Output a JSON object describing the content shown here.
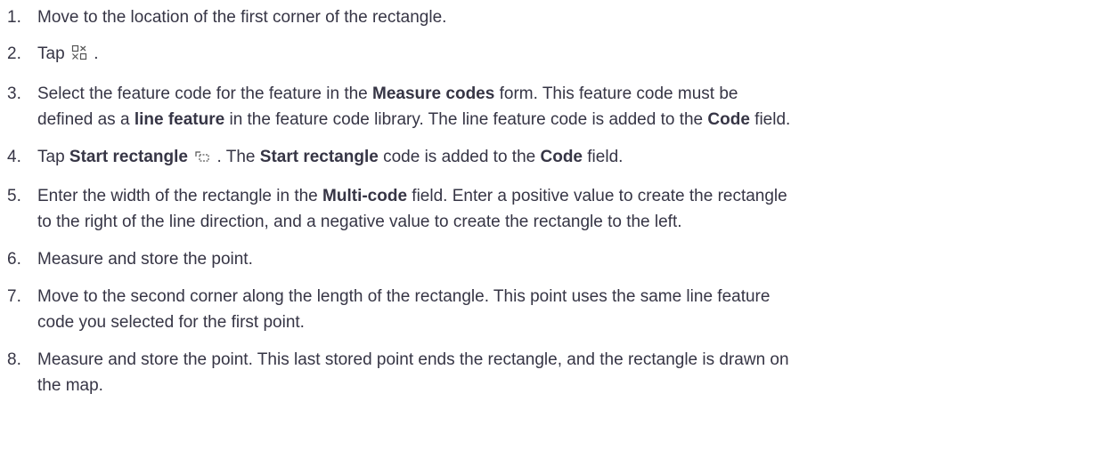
{
  "steps": [
    {
      "number": "1.",
      "text": "Move to the location of the first corner of the rectangle."
    },
    {
      "number": "2.",
      "pre": "Tap ",
      "icon": "measure-codes-icon",
      "post": " ."
    },
    {
      "number": "3.",
      "t1": "Select the feature code for the feature in the ",
      "b1": "Measure codes",
      "t2": " form. This feature code must be",
      "t3": "defined as a ",
      "b2": "line feature",
      "t4": " in the feature code library. The line feature code is added to the ",
      "b3": "Code",
      "t5": " field."
    },
    {
      "number": "4.",
      "t1": "Tap ",
      "b1": "Start rectangle",
      "icon": "start-rectangle-icon",
      "t2": " . The ",
      "b2": "Start rectangle",
      "t3": " code is added to the ",
      "b3": "Code",
      "t4": " field."
    },
    {
      "number": "5.",
      "t1": "Enter the width of the rectangle in the ",
      "b1": "Multi-code",
      "t2": " field. Enter a positive value to create the rectangle",
      "t3": "to the right of the line direction, and a negative value to create the rectangle to the left."
    },
    {
      "number": "6.",
      "text": "Measure and store the point."
    },
    {
      "number": "7.",
      "t1": "Move to the second corner along the length of the rectangle. This point uses the same line feature",
      "t2": "code you selected for the first point."
    },
    {
      "number": "8.",
      "t1": "Measure and store the point. This last stored point ends the rectangle, and the rectangle is drawn on",
      "t2": "the map."
    }
  ]
}
